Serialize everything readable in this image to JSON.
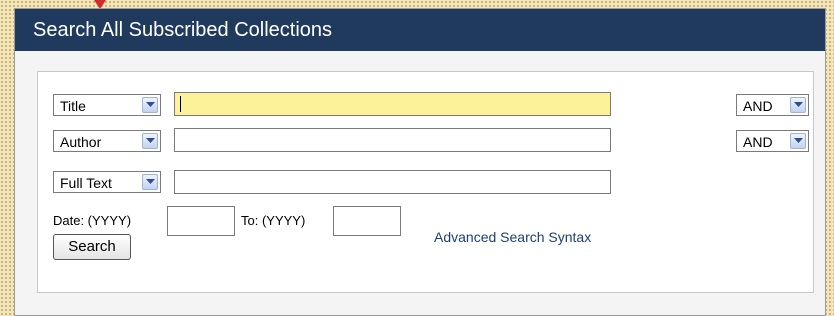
{
  "header": {
    "title": "Search All Subscribed Collections"
  },
  "rows": [
    {
      "field": "Title",
      "operator": "AND"
    },
    {
      "field": "Author",
      "operator": "AND"
    },
    {
      "field": "Full Text"
    }
  ],
  "date": {
    "from_label": "Date: (YYYY)",
    "to_label": "To: (YYYY)"
  },
  "actions": {
    "search_label": "Search",
    "advanced_link": "Advanced Search Syntax"
  },
  "icons": {
    "dropdown": "chevron-down-icon",
    "marker": "red-triangle-marker-icon"
  },
  "colors": {
    "header_bg": "#1f3a5c",
    "active_input": "#fbf29a",
    "link": "#1f3f73"
  }
}
